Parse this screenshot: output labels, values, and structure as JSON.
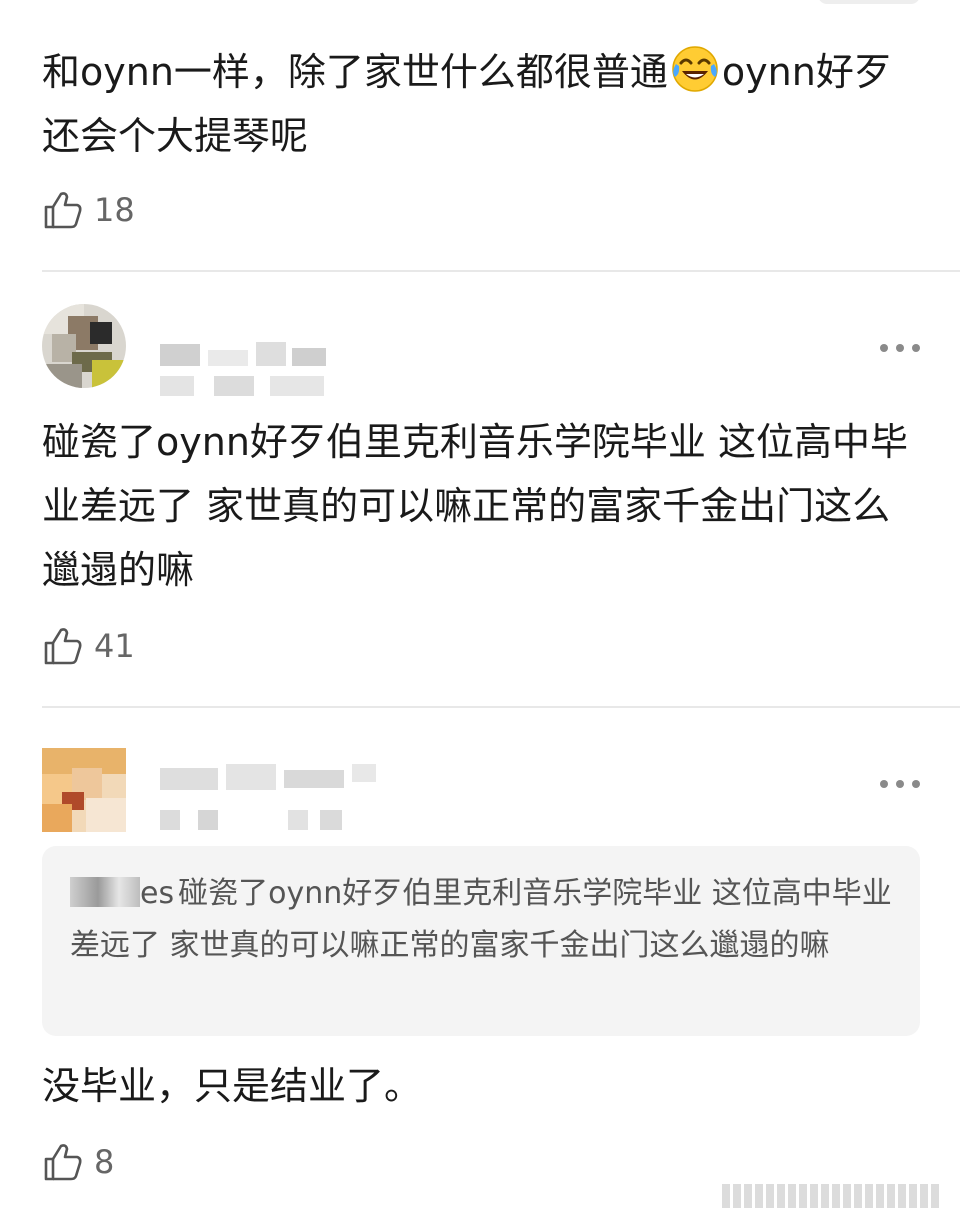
{
  "comments": [
    {
      "text_before_emoji": "和oynn一样，除了家世什么都很普通",
      "emoji": "tears-of-joy-emoji",
      "text_after_emoji": "oynn好歹还会个大提琴呢",
      "likes": "18"
    },
    {
      "username": "",
      "text": "碰瓷了oynn好歹伯里克利音乐学院毕业 这位高中毕业差远了 家世真的可以嘛正常的富家千金出门这么邋遢的嘛",
      "likes": "41"
    },
    {
      "username": "",
      "quote": {
        "user_suffix": "es",
        "text": "碰瓷了oynn好歹伯里克利音乐学院毕业 这位高中毕业差远了 家世真的可以嘛正常的富家千金出门这么邋遢的嘛"
      },
      "text": "没毕业，只是结业了。",
      "likes": "8"
    }
  ],
  "icons": {
    "like": "thumbs-up-outline-icon",
    "more": "ellipsis-more-icon"
  },
  "colors": {
    "text": "#1a1a1a",
    "secondary_text": "#666666",
    "quote_background": "#f4f4f4",
    "divider": "#e8e8e8"
  }
}
